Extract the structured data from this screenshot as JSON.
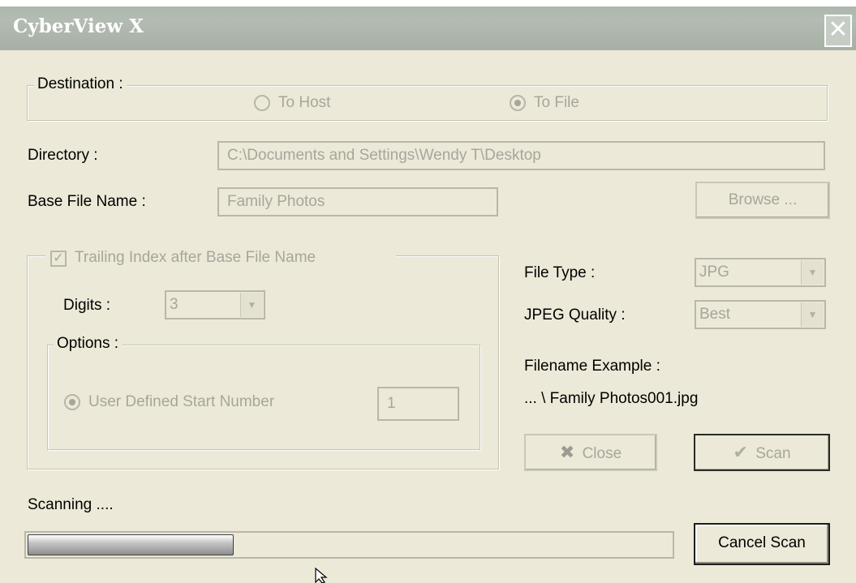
{
  "window": {
    "title": "CyberView X",
    "close_glyph": "✕"
  },
  "destination": {
    "legend": "Destination :",
    "to_host": {
      "label": "To Host",
      "checked": false
    },
    "to_file": {
      "label": "To File",
      "checked": true
    }
  },
  "directory": {
    "label": "Directory :",
    "value": "C:\\Documents and Settings\\Wendy T\\Desktop"
  },
  "base_file_name": {
    "label": "Base File Name :",
    "value": "Family Photos"
  },
  "browse_button": {
    "label": "Browse ..."
  },
  "trailing_index": {
    "checkbox_label": "Trailing Index after Base File Name",
    "checked": true,
    "digits_label": "Digits :",
    "digits_value": "3",
    "options_legend": "Options :",
    "user_defined_label": "User Defined Start Number",
    "start_number": "1"
  },
  "file_type": {
    "label": "File Type :",
    "value": "JPG"
  },
  "jpeg_quality": {
    "label": "JPEG Quality :",
    "value": "Best"
  },
  "filename_example": {
    "label": "Filename Example :",
    "value": "... \\ Family Photos001.jpg"
  },
  "close_button": {
    "label": "Close",
    "icon": "x-icon"
  },
  "scan_button": {
    "label": "Scan",
    "icon": "scan-icon"
  },
  "status": {
    "text": "Scanning ...."
  },
  "progress": {
    "fraction": 0.32
  },
  "cancel_scan_button": {
    "label": "Cancel Scan"
  }
}
